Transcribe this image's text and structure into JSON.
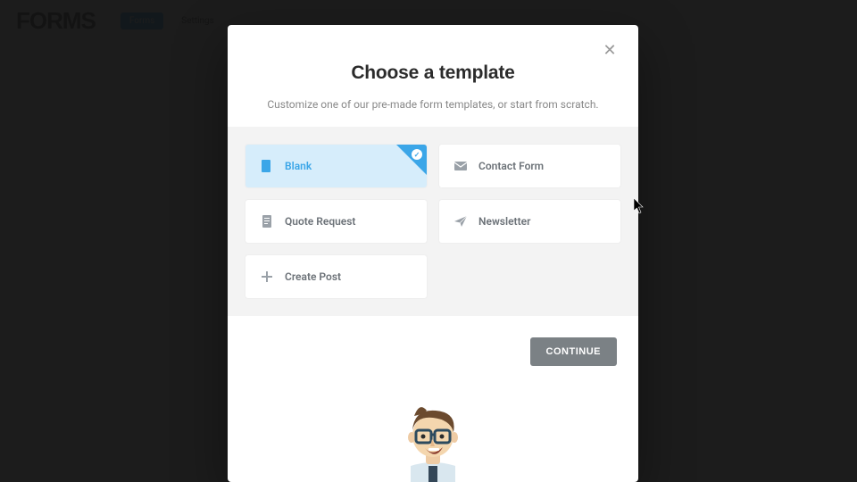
{
  "page": {
    "brand": "FORMS",
    "tab1": "Forms",
    "tab2": "Settings"
  },
  "modal": {
    "title": "Choose a template",
    "subtitle": "Customize one of our pre-made form templates, or start from scratch.",
    "templates": [
      {
        "label": "Blank",
        "icon": "blank",
        "selected": true
      },
      {
        "label": "Contact Form",
        "icon": "mail",
        "selected": false
      },
      {
        "label": "Quote Request",
        "icon": "doc",
        "selected": false
      },
      {
        "label": "Newsletter",
        "icon": "plane",
        "selected": false
      },
      {
        "label": "Create Post",
        "icon": "plus",
        "selected": false
      }
    ],
    "continue": "CONTINUE"
  }
}
